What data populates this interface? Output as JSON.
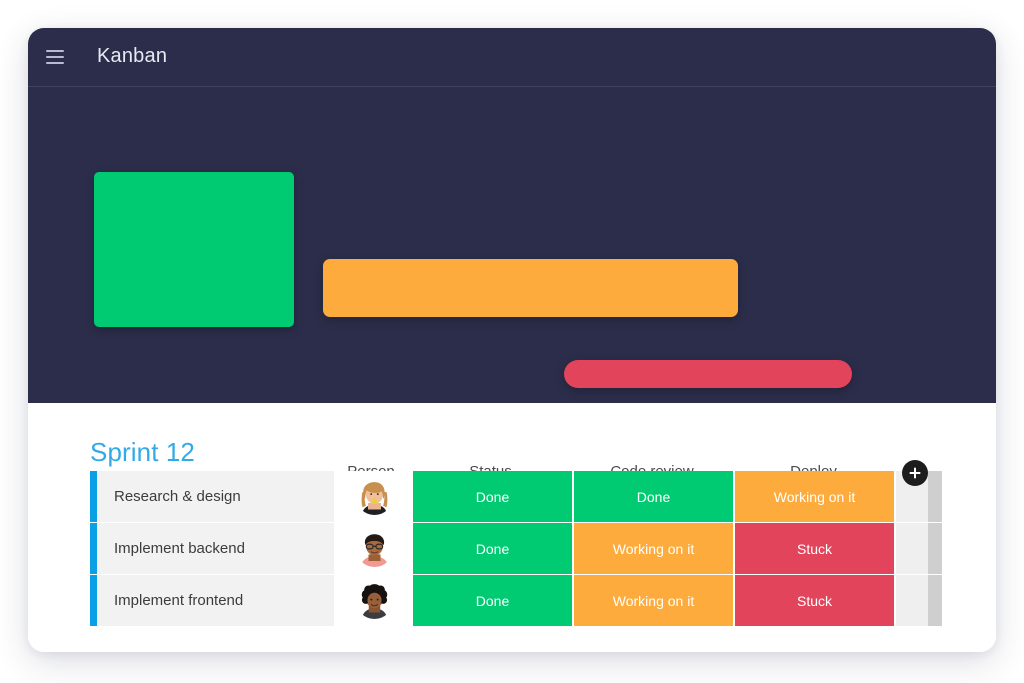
{
  "app": {
    "title": "Kanban",
    "menu_icon": "hamburger-menu-icon"
  },
  "theme": {
    "hero_bg": "#2B2D4A",
    "accent_blue": "#0AA0E6",
    "title_blue": "#33AAE8",
    "green": "#00CA72",
    "orange": "#FDAB3D",
    "red": "#E2445C",
    "row_bg": "#F2F2F2",
    "card_bg": "#FFFFFF"
  },
  "hero": {
    "blocks": [
      {
        "name": "green-block",
        "color": "#00CA72"
      },
      {
        "name": "orange-block",
        "color": "#FDAB3D"
      },
      {
        "name": "red-block",
        "color": "#E2445C"
      }
    ]
  },
  "board": {
    "group_title": "Sprint 12",
    "add_button_label": "+",
    "columns": [
      "Person",
      "Status",
      "Code review",
      "Deploy"
    ],
    "rows": [
      {
        "title": "Research & design",
        "person": "avatar-woman-blonde",
        "status": {
          "label": "Done",
          "color": "#00CA72"
        },
        "code_review": {
          "label": "Done",
          "color": "#00CA72"
        },
        "deploy": {
          "label": "Working on it",
          "color": "#FDAB3D"
        }
      },
      {
        "title": "Implement backend",
        "person": "avatar-man-glasses",
        "status": {
          "label": "Done",
          "color": "#00CA72"
        },
        "code_review": {
          "label": "Working on it",
          "color": "#FDAB3D"
        },
        "deploy": {
          "label": "Stuck",
          "color": "#E2445C"
        }
      },
      {
        "title": "Implement frontend",
        "person": "avatar-woman-curly",
        "status": {
          "label": "Done",
          "color": "#00CA72"
        },
        "code_review": {
          "label": "Working on it",
          "color": "#FDAB3D"
        },
        "deploy": {
          "label": "Stuck",
          "color": "#E2445C"
        }
      }
    ]
  }
}
